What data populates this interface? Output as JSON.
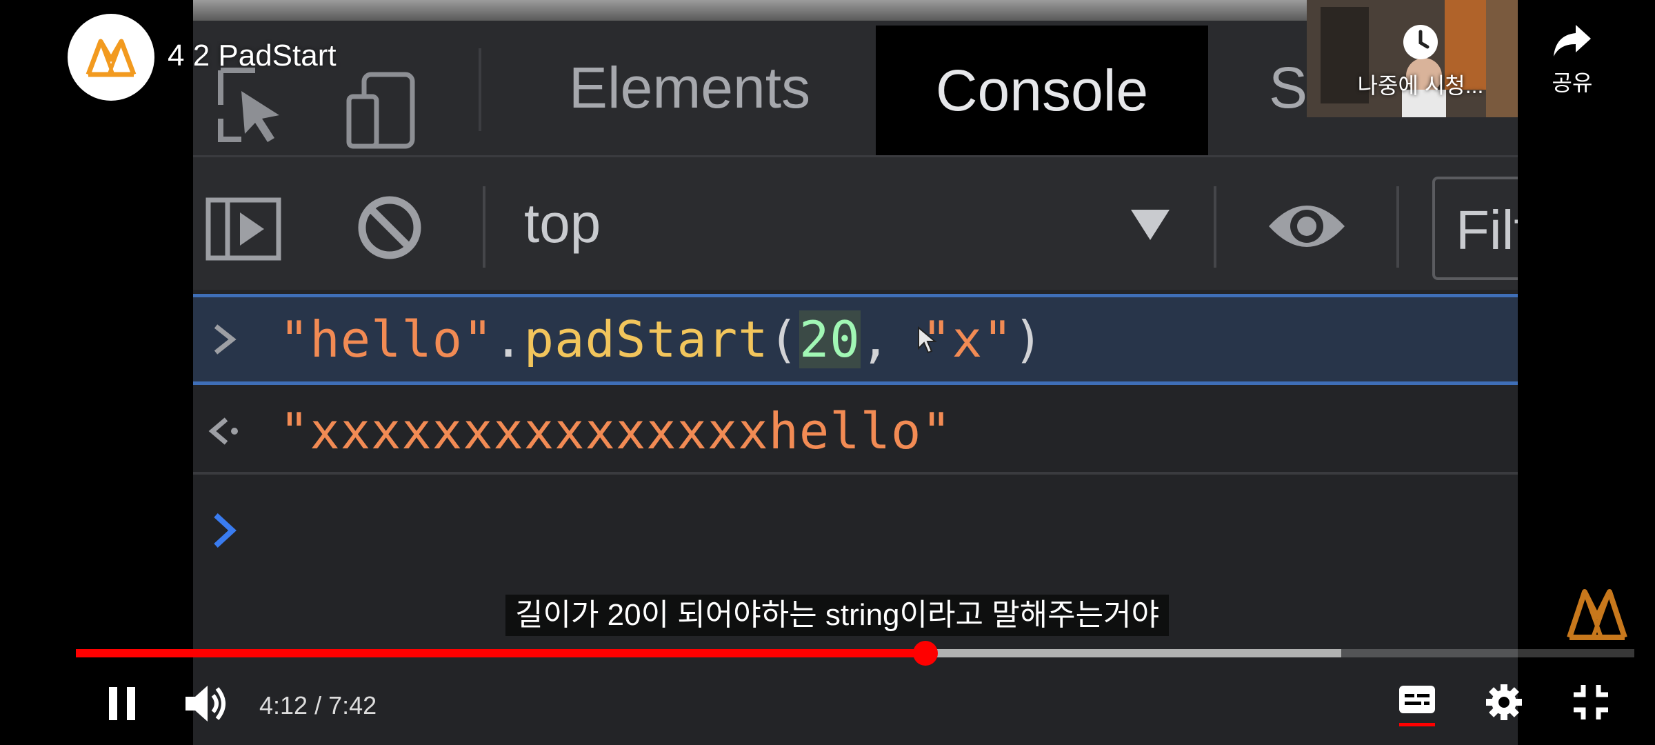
{
  "video": {
    "title": "4 2 PadStart",
    "channel_avatar_icon": "channel-logo-icon",
    "accent_color": "#f29a1f"
  },
  "devtools": {
    "tabs": [
      "Elements",
      "Console",
      "S"
    ],
    "active_tab": "Console",
    "toolbar": {
      "context": "top",
      "filter_placeholder": "Filter",
      "icons": [
        "sidebar-toggle-icon",
        "clear-console-icon",
        "dropdown-caret-icon",
        "live-expression-eye-icon"
      ]
    },
    "console": {
      "input_prompt": ">",
      "input": {
        "str1": "\"hello\"",
        "dot": ".",
        "fn": "padStart",
        "open": "(",
        "num": "20",
        "comma": ", ",
        "str2": "\"x\"",
        "close": ")"
      },
      "output_prompt": "<·",
      "output": "\"xxxxxxxxxxxxxxxhello\"",
      "empty_prompt": ">"
    }
  },
  "overlay": {
    "watch_later_label": "나중에 시청...",
    "share_label": "공유",
    "caption": "길이가 20이 되어야하는 string이라고 말해주는거야"
  },
  "player": {
    "time_display": "4:12 / 7:42",
    "played_fraction": 0.545,
    "buffered_fraction": 0.812,
    "controls": [
      "pause-icon",
      "volume-icon",
      "subtitles-icon",
      "settings-icon",
      "exit-fullscreen-icon"
    ]
  }
}
